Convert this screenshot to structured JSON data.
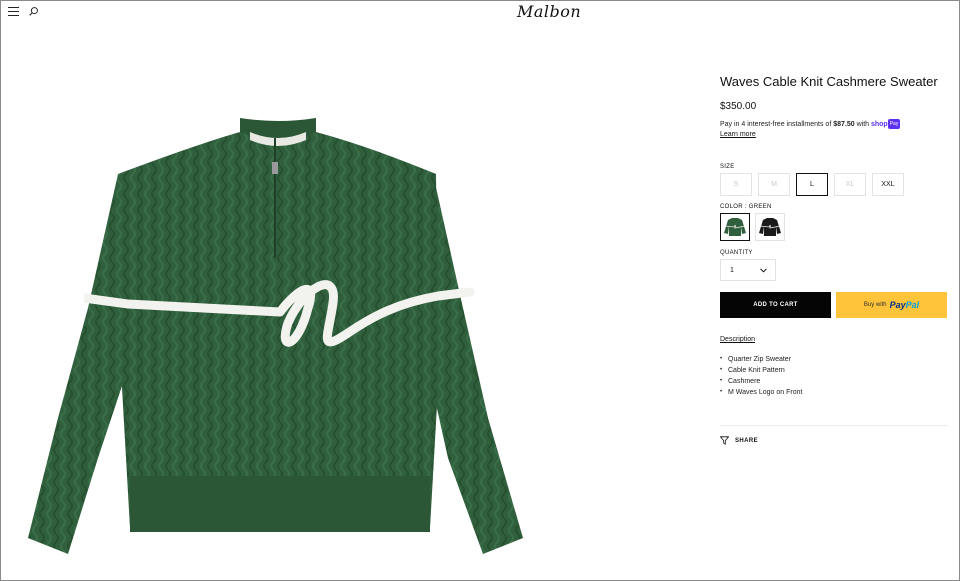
{
  "header": {
    "menu_icon": "hamburger-menu-icon",
    "search_icon": "search-icon",
    "logo_text": "Malbon"
  },
  "product": {
    "title": "Waves Cable Knit Cashmere Sweater",
    "price": "$350.00",
    "image_alt": "Green cable knit quarter zip sweater with white M wave logo",
    "colors": {
      "sweater_green": "#2f5f3c",
      "logo_white": "#f2f2ee"
    }
  },
  "installments": {
    "prefix": "Pay in 4 interest-free installments of ",
    "amount": "$87.50",
    "middle": " with ",
    "shop": "shop",
    "pay_badge": "Pay",
    "learn_more": "Learn more"
  },
  "size": {
    "label": "SIZE",
    "options": [
      "S",
      "M",
      "L",
      "XL",
      "XXL"
    ],
    "selected": "L"
  },
  "color": {
    "label": "COLOR : GREEN",
    "options": [
      {
        "name": "Green",
        "hex": "#2f5f3c",
        "selected": true
      },
      {
        "name": "Black",
        "hex": "#1a1a1a",
        "selected": false
      }
    ]
  },
  "quantity": {
    "label": "QUANTITY",
    "value": "1"
  },
  "buttons": {
    "add_to_cart": "ADD TO CART",
    "paypal_prefix": "Buy with",
    "paypal_brand_1": "Pay",
    "paypal_brand_2": "Pal",
    "accent_black": "#050505",
    "paypal_yellow": "#ffc439"
  },
  "description": {
    "heading": "Description",
    "items": [
      "Quarter Zip Sweater",
      "Cable Knit  Pattern",
      "Cashmere",
      "M Waves Logo on Front"
    ]
  },
  "share": {
    "label": "SHARE",
    "icon": "filter-share-icon"
  }
}
